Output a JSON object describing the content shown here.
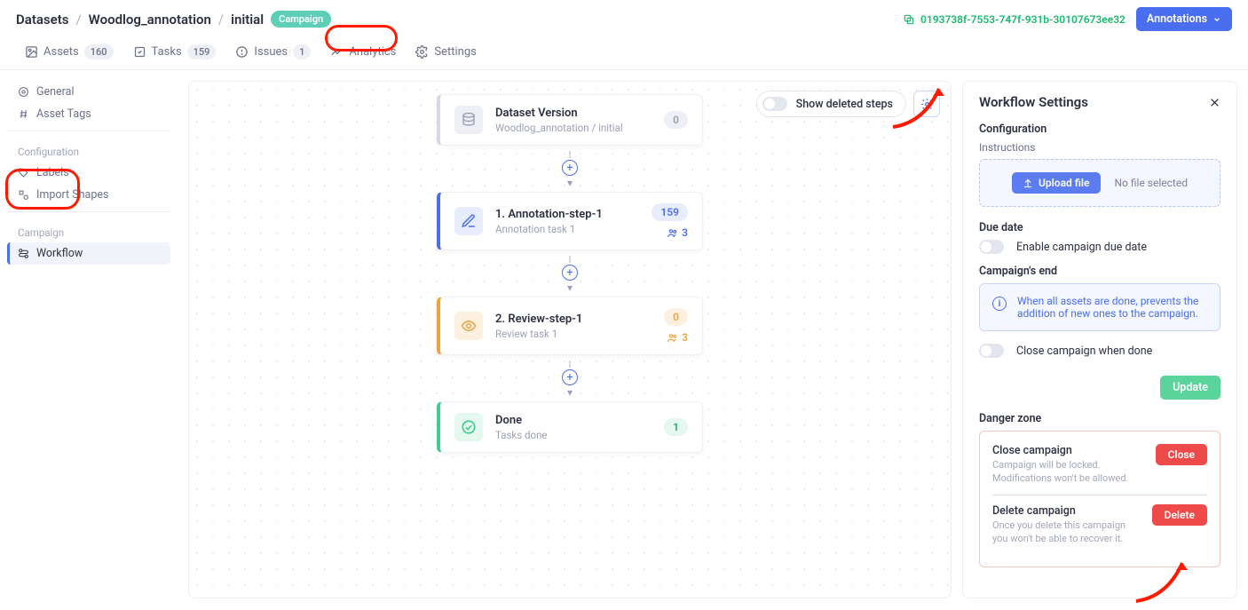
{
  "breadcrumb": {
    "root": "Datasets",
    "project": "Woodlog_annotation",
    "stage": "initial"
  },
  "chip": "Campaign",
  "copy_id": "0193738f-7553-747f-931b-30107673ee32",
  "annotations_btn": "Annotations",
  "tabs": {
    "assets": {
      "label": "Assets",
      "count": "160"
    },
    "tasks": {
      "label": "Tasks",
      "count": "159"
    },
    "issues": {
      "label": "Issues",
      "count": "1"
    },
    "analytics": {
      "label": "Analytics"
    },
    "settings": {
      "label": "Settings"
    }
  },
  "sidebar": {
    "general": "General",
    "asset_tags": "Asset Tags",
    "group_config": "Configuration",
    "labels": "Labels",
    "import_shapes": "Import Shapes",
    "group_campaign": "Campaign",
    "workflow": "Workflow"
  },
  "canvas": {
    "show_deleted": "Show deleted steps",
    "cards": {
      "dataset": {
        "title": "Dataset Version",
        "sub": "Woodlog_annotation / initial",
        "count": "0"
      },
      "annot": {
        "title": "1. Annotation-step-1",
        "sub": "Annotation task 1",
        "count": "159",
        "people": "3"
      },
      "review": {
        "title": "2. Review-step-1",
        "sub": "Review task 1",
        "count": "0",
        "people": "3"
      },
      "done": {
        "title": "Done",
        "sub": "Tasks done",
        "count": "1"
      }
    }
  },
  "panel": {
    "title": "Workflow Settings",
    "sect_config": "Configuration",
    "instructions": "Instructions",
    "upload_btn": "Upload file",
    "no_file": "No file selected",
    "due_date": "Due date",
    "enable_due": "Enable campaign due date",
    "campaign_end": "Campaign's end",
    "end_info": "When all assets are done, prevents the addition of new ones to the campaign.",
    "close_when_done": "Close campaign when done",
    "update": "Update",
    "danger": "Danger zone",
    "close_t": "Close campaign",
    "close_s": "Campaign will be locked. Modifications won't be allowed.",
    "close_b": "Close",
    "delete_t": "Delete campaign",
    "delete_s": "Once you delete this campaign you won't be able to recover it.",
    "delete_b": "Delete"
  }
}
